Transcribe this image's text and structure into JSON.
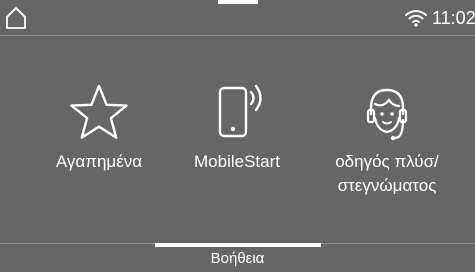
{
  "status_bar": {
    "home_icon": "home-icon",
    "wifi_icon": "wifi-icon",
    "time": "11:02"
  },
  "tiles": [
    {
      "icon": "star-icon",
      "label": "Αγαπημένα"
    },
    {
      "icon": "phone-signal-icon",
      "label": "MobileStart"
    },
    {
      "icon": "headset-person-icon",
      "label": "οδηγός πλύσ/\nστεγνώματος"
    }
  ],
  "bottom_bar": {
    "help_label": "Βοήθεια"
  },
  "colors": {
    "background": "#666666",
    "foreground": "#ffffff",
    "divider": "#8a8a8a"
  }
}
